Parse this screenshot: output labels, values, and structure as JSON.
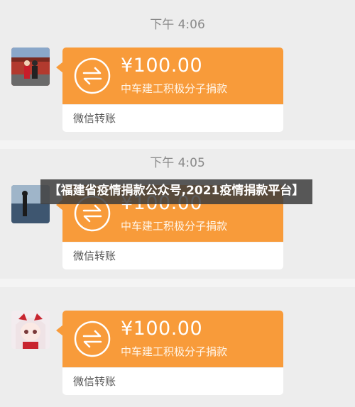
{
  "messages": [
    {
      "timestamp": "下午 4:06",
      "amount": "¥100.00",
      "description": "中车建工积极分子捐款",
      "footer": "微信转账",
      "avatar": "avatar-couple-photo"
    },
    {
      "timestamp": "下午 4:05",
      "amount": "¥100.00",
      "description": "中车建工积极分子捐款",
      "footer": "微信转账",
      "avatar": "avatar-silhouette-sea-photo"
    },
    {
      "timestamp": "",
      "amount": "¥100.00",
      "description": "中车建工积极分子捐款",
      "footer": "微信转账",
      "avatar": "avatar-anime-girl"
    }
  ],
  "overlay": {
    "caption": "【福建省疫情捐款公众号,2021疫情捐款平台】"
  },
  "colors": {
    "card_orange": "#f89b3a",
    "background": "#ededed",
    "timestamp": "#8a8a8a"
  },
  "icons": {
    "transfer": "transfer-arrows-icon"
  }
}
